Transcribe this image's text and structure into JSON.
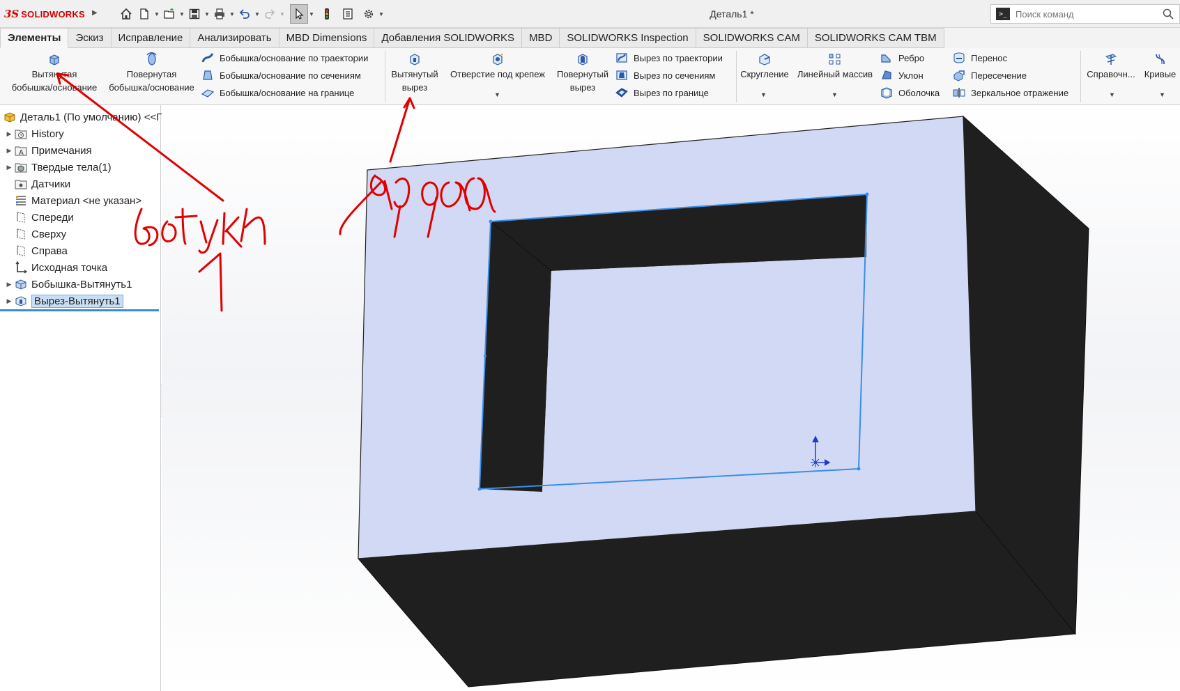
{
  "app": {
    "brand_prefix": "3S",
    "brand_name": "SOLIDWORKS",
    "document_title": "Деталь1 *"
  },
  "search": {
    "placeholder": "Поиск команд",
    "prompt_glyph": ">_"
  },
  "tabs": [
    {
      "label": "Элементы",
      "active": true
    },
    {
      "label": "Эскиз"
    },
    {
      "label": "Исправление"
    },
    {
      "label": "Анализировать"
    },
    {
      "label": "MBD Dimensions"
    },
    {
      "label": "Добавления SOLIDWORKS"
    },
    {
      "label": "MBD"
    },
    {
      "label": "SOLIDWORKS Inspection"
    },
    {
      "label": "SOLIDWORKS CAM"
    },
    {
      "label": "SOLIDWORKS CAM TBM"
    }
  ],
  "ribbon": {
    "extrude_boss": {
      "line1": "Вытянутая",
      "line2": "бобышка/основание"
    },
    "revolve_boss": {
      "line1": "Повернутая",
      "line2": "бобышка/основание"
    },
    "sweep_boss": "Бобышка/основание по траектории",
    "loft_boss": "Бобышка/основание по сечениям",
    "boundary_boss": "Бобышка/основание на границе",
    "extrude_cut": {
      "line1": "Вытянутый",
      "line2": "вырез"
    },
    "hole_wizard": "Отверстие под крепеж",
    "revolve_cut": {
      "line1": "Повернутый",
      "line2": "вырез"
    },
    "sweep_cut": "Вырез по траектории",
    "loft_cut": "Вырез по сечениям",
    "boundary_cut": "Вырез по границе",
    "fillet": "Скругление",
    "linear_pattern": "Линейный массив",
    "rib": "Ребро",
    "draft": "Уклон",
    "shell": "Оболочка",
    "wrap": "Перенос",
    "intersect": "Пересечение",
    "mirror": "Зеркальное отражение",
    "reference": "Справочн...",
    "curves": "Кривые"
  },
  "tree": {
    "root": "Деталь1 (По умолчанию)  <<П",
    "items": [
      {
        "label": "History",
        "icon": "history-folder-icon",
        "expandable": true
      },
      {
        "label": "Примечания",
        "icon": "annotations-icon",
        "expandable": true
      },
      {
        "label": "Твердые тела(1)",
        "icon": "solid-bodies-icon",
        "expandable": true
      },
      {
        "label": "Датчики",
        "icon": "sensors-icon",
        "expandable": false
      },
      {
        "label": "Материал <не указан>",
        "icon": "material-icon",
        "expandable": false
      },
      {
        "label": "Спереди",
        "icon": "plane-icon",
        "expandable": false
      },
      {
        "label": "Сверху",
        "icon": "plane-icon",
        "expandable": false
      },
      {
        "label": "Справа",
        "icon": "plane-icon",
        "expandable": false
      },
      {
        "label": "Исходная точка",
        "icon": "origin-icon",
        "expandable": false
      },
      {
        "label": "Бобышка-Вытянуть1",
        "icon": "boss-extrude-icon",
        "expandable": true
      },
      {
        "label": "Вырез-Вытянуть1",
        "icon": "cut-extrude-icon",
        "expandable": true,
        "selected": true
      }
    ]
  },
  "colors": {
    "face_light": "#d2d9f4",
    "face_dark": "#1f1f1f",
    "edge_highlight": "#3a8ee6",
    "annotation": "#e00000",
    "tree_selection": "#c9def5"
  }
}
